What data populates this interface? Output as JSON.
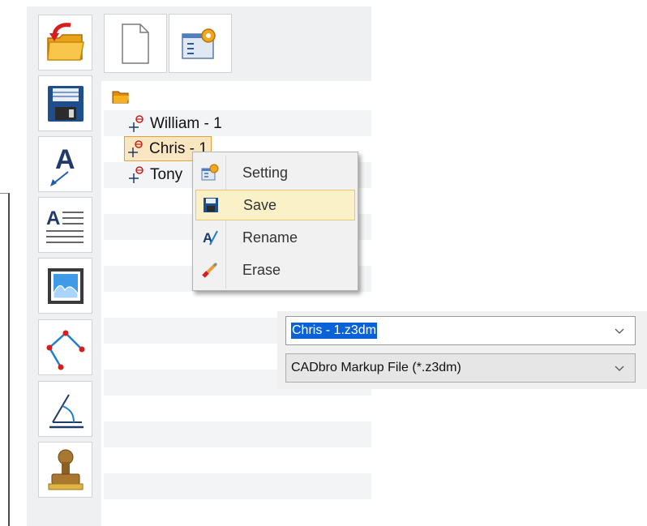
{
  "toolbar_left": {
    "buttons": [
      {
        "icon": "open-folder-icon"
      },
      {
        "icon": "save-disk-icon"
      },
      {
        "icon": "text-annotation-icon"
      },
      {
        "icon": "text-block-icon"
      },
      {
        "icon": "image-icon"
      },
      {
        "icon": "polyline-icon"
      },
      {
        "icon": "angle-dimension-icon"
      },
      {
        "icon": "stamp-icon"
      }
    ]
  },
  "toolbar_top": {
    "buttons": [
      {
        "icon": "new-document-icon"
      },
      {
        "icon": "settings-window-icon"
      }
    ]
  },
  "tree": {
    "root_icon": "folder-icon",
    "nodes": [
      {
        "label": "William - 1",
        "icon": "markup-node-icon"
      },
      {
        "label": "Chris - 1",
        "icon": "markup-node-icon",
        "selected": true
      },
      {
        "label": "Tony",
        "icon": "markup-node-icon"
      }
    ]
  },
  "context_menu": {
    "items": [
      {
        "label": "Setting",
        "icon": "setting-icon"
      },
      {
        "label": "Save",
        "icon": "save-icon",
        "highlighted": true
      },
      {
        "label": "Rename",
        "icon": "rename-icon"
      },
      {
        "label": "Erase",
        "icon": "erase-icon"
      }
    ]
  },
  "save_dialog": {
    "filename": "Chris - 1.z3dm",
    "file_type": "CADbro Markup File (*.z3dm)"
  },
  "colors": {
    "selection_blue": "#0a63d6",
    "menu_highlight": "#fbf1c9",
    "node_selected": "#fbe6c2"
  }
}
